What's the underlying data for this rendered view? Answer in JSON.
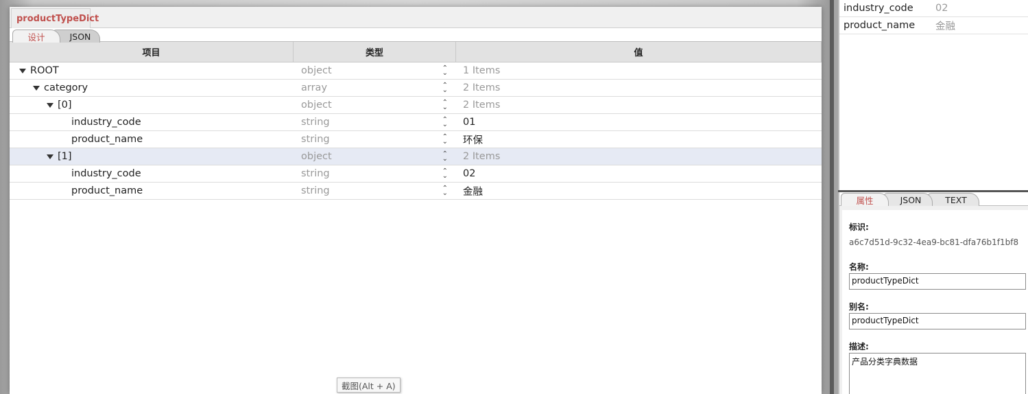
{
  "document_tab": "productTypeDict",
  "view_tabs": {
    "design": "设计",
    "json": "JSON"
  },
  "grid": {
    "headers": {
      "name": "项目",
      "type": "类型",
      "value": "值"
    },
    "rows": [
      {
        "name": "ROOT",
        "type": "object",
        "value": "1 Items"
      },
      {
        "name": "category",
        "type": "array",
        "value": "2 Items"
      },
      {
        "name": "[0]",
        "type": "object",
        "value": "2 Items"
      },
      {
        "name": "industry_code",
        "type": "string",
        "value": "01"
      },
      {
        "name": "product_name",
        "type": "string",
        "value": "环保"
      },
      {
        "name": "[1]",
        "type": "object",
        "value": "2 Items"
      },
      {
        "name": "industry_code",
        "type": "string",
        "value": "02"
      },
      {
        "name": "product_name",
        "type": "string",
        "value": "金融"
      }
    ]
  },
  "tooltip": "截图(Alt + A)",
  "detail_list": [
    {
      "key": "industry_code",
      "value": "02"
    },
    {
      "key": "product_name",
      "value": "金融"
    }
  ],
  "props": {
    "tabs": {
      "attr": "属性",
      "json": "JSON",
      "text": "TEXT"
    },
    "id_label": "标识:",
    "id_value": "a6c7d51d-9c32-4ea9-bc81-dfa76b1f1bf8",
    "name_label": "名称:",
    "name_value": "productTypeDict",
    "alias_label": "别名:",
    "alias_value": "productTypeDict",
    "desc_label": "描述:",
    "desc_value": "产品分类字典数据"
  },
  "colors": {
    "accent": "#c0504d",
    "selected_row": "#e6eaf4"
  }
}
